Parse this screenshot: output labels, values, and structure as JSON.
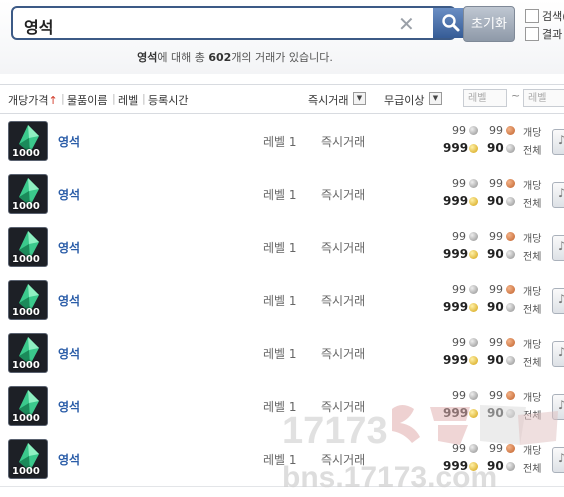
{
  "search": {
    "query": "영석",
    "clear_icon": "close-icon",
    "search_icon": "magnifier-icon",
    "reset_label": "초기화",
    "option1_label": "검색(",
    "option2_label": "결과"
  },
  "result_summary": {
    "term": "영석",
    "prefix": "에 대해 총 ",
    "count": "602",
    "suffix": "개의 거래가 있습니다."
  },
  "filters": {
    "sort_price": "개당가격",
    "sort_price_arrow": "↑",
    "sort_name": "물품이름",
    "sort_level": "레벨",
    "sort_time": "등록시간",
    "trade_type": "즉시거래",
    "grade": "무급이상",
    "level_min_placeholder": "레벨",
    "level_range_sep": "~",
    "level_max_placeholder": "레벨"
  },
  "rows": [
    {
      "qty": "1000",
      "name": "영석",
      "level": "레벨 1",
      "type": "즉시거래",
      "unit_a": "99",
      "unit_b": "99",
      "unit_label": "개당",
      "total_a": "999",
      "total_b": "90",
      "total_label": "전체"
    },
    {
      "qty": "1000",
      "name": "영석",
      "level": "레벨 1",
      "type": "즉시거래",
      "unit_a": "99",
      "unit_b": "99",
      "unit_label": "개당",
      "total_a": "999",
      "total_b": "90",
      "total_label": "전체"
    },
    {
      "qty": "1000",
      "name": "영석",
      "level": "레벨 1",
      "type": "즉시거래",
      "unit_a": "99",
      "unit_b": "99",
      "unit_label": "개당",
      "total_a": "999",
      "total_b": "90",
      "total_label": "전체"
    },
    {
      "qty": "1000",
      "name": "영석",
      "level": "레벨 1",
      "type": "즉시거래",
      "unit_a": "99",
      "unit_b": "99",
      "unit_label": "개당",
      "total_a": "999",
      "total_b": "90",
      "total_label": "전체"
    },
    {
      "qty": "1000",
      "name": "영석",
      "level": "레벨 1",
      "type": "즉시거래",
      "unit_a": "99",
      "unit_b": "99",
      "unit_label": "개당",
      "total_a": "999",
      "total_b": "90",
      "total_label": "전체"
    },
    {
      "qty": "1000",
      "name": "영석",
      "level": "레벨 1",
      "type": "즉시거래",
      "unit_a": "99",
      "unit_b": "99",
      "unit_label": "개당",
      "total_a": "999",
      "total_b": "90",
      "total_label": "전체"
    },
    {
      "qty": "1000",
      "name": "영석",
      "level": "레벨 1",
      "type": "즉시거래",
      "unit_a": "99",
      "unit_b": "99",
      "unit_label": "개당",
      "total_a": "999",
      "total_b": "90",
      "total_label": "전체"
    }
  ],
  "watermark": {
    "line1": "17173",
    "line2": "bns.17173.com"
  },
  "colors": {
    "accent": "#3c5a86",
    "item_name": "#2b5da8"
  }
}
